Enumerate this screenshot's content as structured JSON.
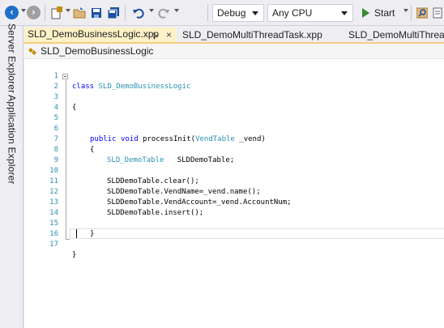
{
  "toolbar": {
    "config": "Debug",
    "platform": "Any CPU",
    "start_label": "Start",
    "icons": [
      "back-icon",
      "forward-icon",
      "new-item-icon",
      "open-folder-icon",
      "save-icon",
      "save-all-icon",
      "undo-icon",
      "redo-icon",
      "start-icon",
      "find-icon"
    ]
  },
  "side_tabs": {
    "server_explorer": "Server Explorer",
    "application_explorer": "Application Explorer"
  },
  "tabs": {
    "active": "SLD_DemoBusinessLogic.xpp",
    "second": "SLD_DemoMultiThreadTask.xpp",
    "third": "SLD_DemoMultiThread"
  },
  "breadcrumb": "SLD_DemoBusinessLogic",
  "code_lines": {
    "l1": {
      "n": "1",
      "kw": "class",
      "ty": "SLD_DemoBusinessLogic"
    },
    "l2": {
      "n": "2",
      "t": "{"
    },
    "l3": {
      "n": "3"
    },
    "l4": {
      "n": "4"
    },
    "l5": {
      "n": "5"
    },
    "l6": {
      "n": "6",
      "kw1": "public",
      "kw2": "void",
      "mid": "processInit(",
      "ty": "VendTable",
      "end": " _vend)"
    },
    "l7": {
      "n": "7",
      "t": "{"
    },
    "l8": {
      "n": "8",
      "ty": "SLD_DemoTable",
      "end": "SLDDemoTable;"
    },
    "l9": {
      "n": "9"
    },
    "l10": {
      "n": "10",
      "t": "SLDDemoTable.clear();"
    },
    "l11": {
      "n": "11",
      "t": "SLDDemoTable.VendName=_vend.name();"
    },
    "l12": {
      "n": "12",
      "t": "SLDDemoTable.VendAccount=_vend.AccountNum;"
    },
    "l13": {
      "n": "13",
      "t": "SLDDemoTable.insert();"
    },
    "l14": {
      "n": "14"
    },
    "l15": {
      "n": "15",
      "t": "}"
    },
    "l16": {
      "n": "16"
    },
    "l17": {
      "n": "17",
      "t": "}"
    }
  },
  "colors": {
    "keyword": "#0000ff",
    "type": "#2b91af",
    "line_number": "#2b91af",
    "active_tab": "#fff1c7",
    "tab_underline": "#f5cc84"
  }
}
